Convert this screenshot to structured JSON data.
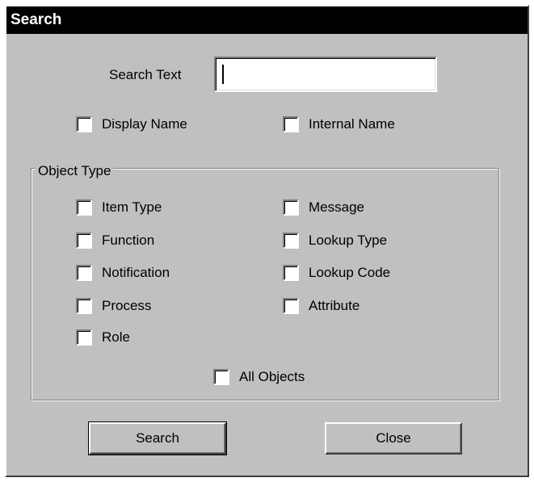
{
  "window": {
    "title": "Search"
  },
  "search_text": {
    "label": "Search Text",
    "value": ""
  },
  "name_options": [
    {
      "label": "Display Name",
      "checked": false
    },
    {
      "label": "Internal Name",
      "checked": false
    }
  ],
  "object_type": {
    "legend": "Object Type",
    "left_column": [
      {
        "label": "Item Type",
        "checked": false
      },
      {
        "label": "Function",
        "checked": false
      },
      {
        "label": "Notification",
        "checked": false
      },
      {
        "label": "Process",
        "checked": false
      },
      {
        "label": "Role",
        "checked": false
      }
    ],
    "right_column": [
      {
        "label": "Message",
        "checked": false
      },
      {
        "label": "Lookup Type",
        "checked": false
      },
      {
        "label": "Lookup Code",
        "checked": false
      },
      {
        "label": "Attribute",
        "checked": false
      }
    ],
    "all_objects": {
      "label": "All Objects",
      "checked": false
    }
  },
  "buttons": {
    "search": "Search",
    "close": "Close"
  }
}
